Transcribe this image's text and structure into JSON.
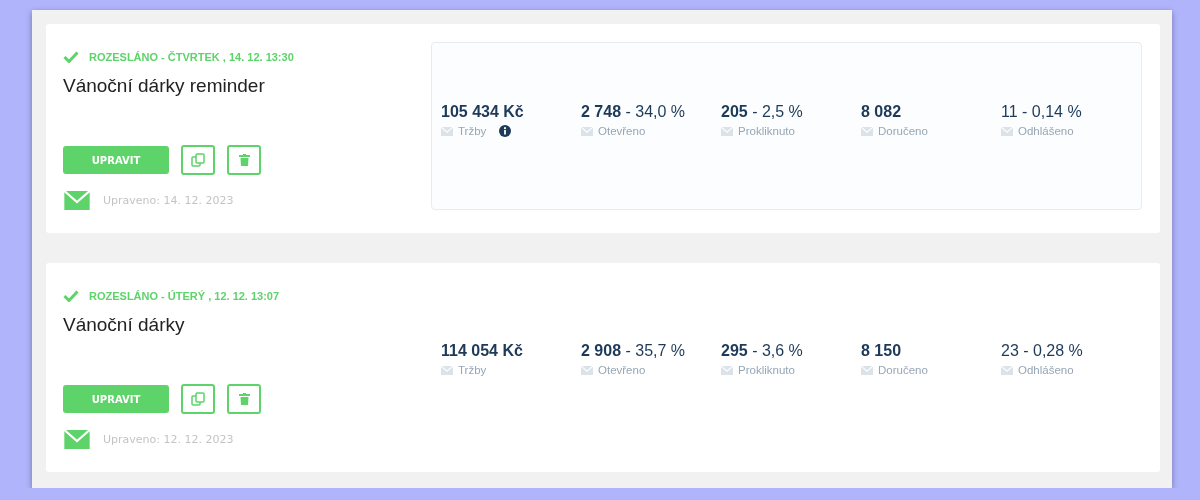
{
  "campaigns": [
    {
      "status": "ROZESLÁNO - ČTVRTEK , 14. 12. 13:30",
      "title": "Vánoční dárky reminder",
      "edit_label": "UPRAVIT",
      "updated": "Upraveno:  14. 12. 2023",
      "highlighted": true,
      "stats": [
        {
          "value": "**105 434 Kč**",
          "label": "Tržby",
          "info": true
        },
        {
          "value": "**2 748** - 34,0 %",
          "label": "Otevřeno"
        },
        {
          "value": "**205** - 2,5 %",
          "label": "Prokliknuto"
        },
        {
          "value": "**8 082**",
          "label": "Doručeno"
        },
        {
          "value": "11 - 0,14 %",
          "label": "Odhlášeno"
        }
      ]
    },
    {
      "status": "ROZESLÁNO - ÚTERÝ , 12. 12. 13:07",
      "title": "Vánoční dárky",
      "edit_label": "UPRAVIT",
      "updated": "Upraveno:  12. 12. 2023",
      "highlighted": false,
      "stats": [
        {
          "value": "**114 054 Kč**",
          "label": "Tržby"
        },
        {
          "value": "**2 908** - 35,7 %",
          "label": "Otevřeno"
        },
        {
          "value": "**295** - 3,6 %",
          "label": "Prokliknuto"
        },
        {
          "value": "**8 150**",
          "label": "Doručeno"
        },
        {
          "value": "23 - 0,28 %",
          "label": "Odhlášeno"
        }
      ]
    }
  ]
}
